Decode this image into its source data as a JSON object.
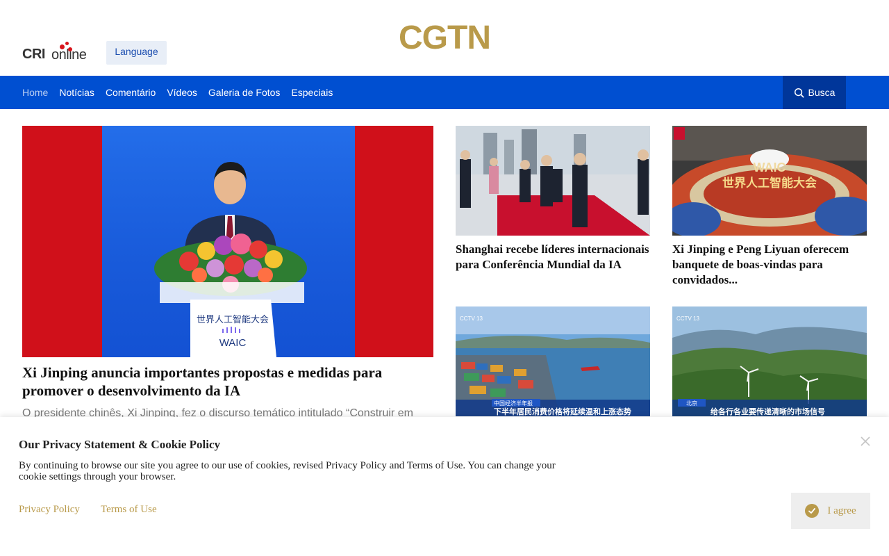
{
  "header": {
    "cri_logo_text": "CRIonline",
    "language_label": "Language",
    "brand": "CGTN"
  },
  "nav": {
    "items": [
      {
        "label": "Home",
        "active": true
      },
      {
        "label": "Notícias"
      },
      {
        "label": "Comentário"
      },
      {
        "label": "Vídeos"
      },
      {
        "label": "Galeria de Fotos"
      },
      {
        "label": "Especiais"
      }
    ],
    "search_label": "Busca"
  },
  "feature": {
    "image_caption_cn": "世界人工智能大会",
    "image_caption_logo": "WAIC",
    "title": "Xi Jinping anuncia importantes propostas e medidas para promover o desenvolvimento da IA",
    "summary": "O presidente chinês, Xi Jinping, fez o discurso temático intitulado “Construir em"
  },
  "cards": [
    {
      "title": "Shanghai recebe líderes internacionais para Conferência Mundial da IA",
      "image_icon": "red-carpet-photo"
    },
    {
      "title": "Xi Jinping e Peng Liyuan oferecem banquete de boas-vindas para convidados...",
      "image_icon": "waic-banquet-photo",
      "image_text": "世界人工智能大会",
      "image_logo": "WAIC"
    },
    {
      "title": "",
      "image_icon": "port-photo",
      "image_text": "下半年居民消费价格将延续温和上涨态势",
      "image_tag": "中国经济半年报",
      "image_channel": "CCTV 13"
    },
    {
      "title": "",
      "image_icon": "wind-turbines-photo",
      "image_text": "给各行各业要传递清晰的市场信号",
      "image_tag": "北京",
      "image_channel": "CCTV 13"
    }
  ],
  "cookie": {
    "title": "Our Privacy Statement & Cookie Policy",
    "text": "By continuing to browse our site you agree to our use of cookies, revised Privacy Policy and Terms of Use. You can change your cookie settings through your browser.",
    "privacy_link": "Privacy Policy",
    "terms_link": "Terms of Use",
    "agree_label": "I agree"
  },
  "colors": {
    "nav_blue": "#004fd1",
    "search_blue": "#00369a",
    "gold": "#b99a4a",
    "cri_red": "#d8141b"
  }
}
